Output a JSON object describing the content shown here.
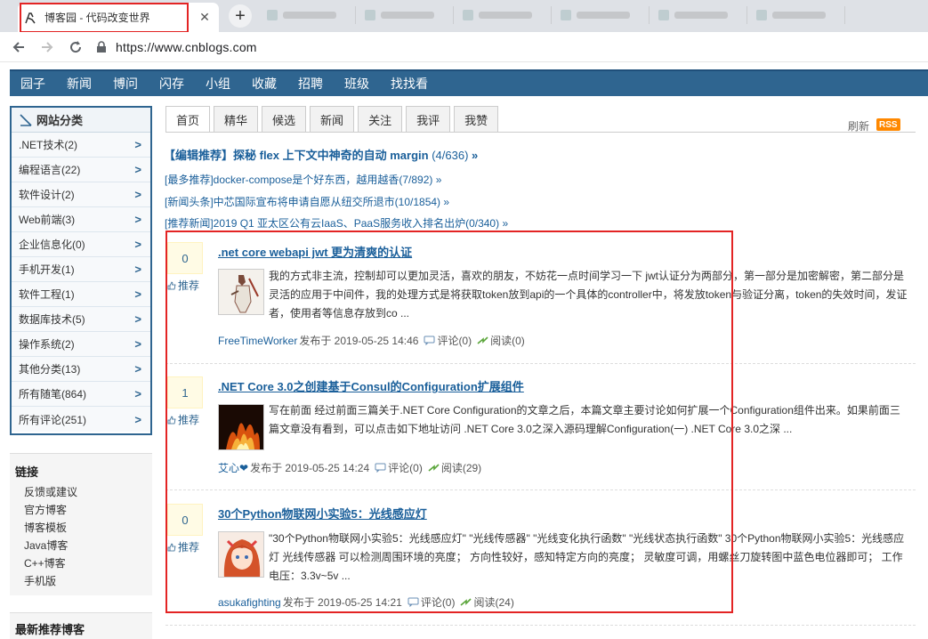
{
  "browser": {
    "active_tab_title": "博客园 - 代码改变世界",
    "close_glyph": "✕",
    "new_tab_glyph": "+",
    "url": "https://www.cnblogs.com"
  },
  "site_nav": [
    "园子",
    "新闻",
    "博问",
    "闪存",
    "小组",
    "收藏",
    "招聘",
    "班级",
    "找找看"
  ],
  "sidebar": {
    "categories_title": "网站分类",
    "categories": [
      ".NET技术(2)",
      "编程语言(22)",
      "软件设计(2)",
      "Web前端(3)",
      "企业信息化(0)",
      "手机开发(1)",
      "软件工程(1)",
      "数据库技术(5)",
      "操作系统(2)",
      "其他分类(13)",
      "所有随笔(864)",
      "所有评论(251)"
    ],
    "arrow_glyph": ">",
    "links_title": "链接",
    "links": [
      "反馈或建议",
      "官方博客",
      "博客模板",
      "Java博客",
      "C++博客",
      "手机版"
    ],
    "recommended_title": "最新推荐博客"
  },
  "main_tabs": [
    "首页",
    "精华",
    "候选",
    "新闻",
    "关注",
    "我评",
    "我赞"
  ],
  "refresh_label": "刷新",
  "rss_label": "RSS",
  "headline": {
    "text": "【编辑推荐】探秘 flex 上下文中神奇的自动 margin",
    "count": "(4/636)",
    "more": "»"
  },
  "news": [
    {
      "text": "[最多推荐]docker-compose是个好东西，越用越香(7/892)",
      "more": "»"
    },
    {
      "text": "[新闻头条]中芯国际宣布将申请自愿从纽交所退市(10/1854)",
      "more": "»"
    },
    {
      "text": "[推荐新闻]2019 Q1 亚太区公有云IaaS、PaaS服务收入排名出炉(0/340)",
      "more": "»"
    }
  ],
  "posts": [
    {
      "digg": "0",
      "recommend_label": "推荐",
      "title": ".net core webapi jwt 更为清爽的认证",
      "summary": "我的方式非主流，控制却可以更加灵活，喜欢的朋友，不妨花一点时间学习一下 jwt认证分为两部分，第一部分是加密解密，第二部分是灵活的应用于中间件，我的处理方式是将获取token放到api的一个具体的controller中，将发放token与验证分离，token的失效时间，发证者，使用者等信息存放到co ...",
      "author": "FreeTimeWorker",
      "date": "发布于 2019-05-25 14:46",
      "comments": "评论(0)",
      "reads": "阅读(0)"
    },
    {
      "digg": "1",
      "recommend_label": "推荐",
      "title": ".NET Core 3.0之创建基于Consul的Configuration扩展组件",
      "summary": "写在前面 经过前面三篇关于.NET Core Configuration的文章之后，本篇文章主要讨论如何扩展一个Configuration组件出来。如果前面三篇文章没有看到，可以点击如下地址访问 .NET Core 3.0之深入源码理解Configuration(一) .NET Core 3.0之深 ...",
      "author": "艾心❤",
      "date": "发布于 2019-05-25 14:24",
      "comments": "评论(0)",
      "reads": "阅读(29)"
    },
    {
      "digg": "0",
      "recommend_label": "推荐",
      "title": "30个Python物联网小实验5：光线感应灯",
      "summary": "\"30个Python物联网小实验5：光线感应灯\" \"光线传感器\" \"光线变化执行函数\" \"光线状态执行函数\" 30个Python物联网小实验5：光线感应灯 光线传感器 可以检测周围环境的亮度； 方向性较好，感知特定方向的亮度； 灵敏度可调，用螺丝刀旋转图中蓝色电位器即可； 工作电压：3.3v~5v ...",
      "author": "asukafighting",
      "date": "发布于 2019-05-25 14:21",
      "comments": "评论(0)",
      "reads": "阅读(24)"
    }
  ],
  "colors": {
    "nav_blue": "#2f6590",
    "link_blue": "#1a5f9a",
    "highlight_red": "#e32424"
  }
}
